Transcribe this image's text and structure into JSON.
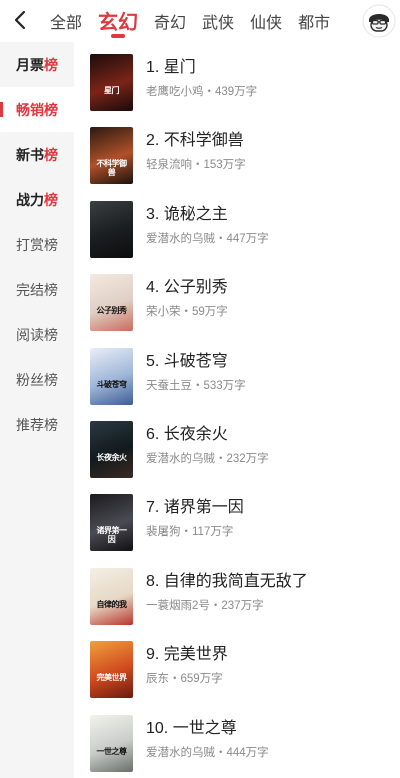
{
  "nav": {
    "tabs": [
      "全部",
      "玄幻",
      "奇幻",
      "武侠",
      "仙侠",
      "都市"
    ],
    "active_tab": 1
  },
  "sidebar": {
    "items": [
      {
        "label": "月票",
        "suffix": "榜",
        "style": "bold"
      },
      {
        "label": "畅销榜",
        "suffix": "",
        "style": "active"
      },
      {
        "label": "新书",
        "suffix": "榜",
        "style": "bold"
      },
      {
        "label": "战力",
        "suffix": "榜",
        "style": "bold"
      },
      {
        "label": "打赏榜",
        "suffix": "",
        "style": "normal"
      },
      {
        "label": "完结榜",
        "suffix": "",
        "style": "normal"
      },
      {
        "label": "阅读榜",
        "suffix": "",
        "style": "normal"
      },
      {
        "label": "粉丝榜",
        "suffix": "",
        "style": "normal"
      },
      {
        "label": "推荐榜",
        "suffix": "",
        "style": "normal"
      }
    ]
  },
  "books": [
    {
      "title": "1. 星门",
      "meta": "老鹰吃小鸡・439万字",
      "cover_text": "星门",
      "cover_colors": [
        "#1b0d0b",
        "#7a2418",
        "#1a0a0a"
      ],
      "cover_text_dark": false
    },
    {
      "title": "2. 不科学御兽",
      "meta": "轻泉流响・153万字",
      "cover_text": "不科学御兽",
      "cover_colors": [
        "#2a1a10",
        "#b0502a",
        "#1a120c"
      ],
      "cover_text_dark": false
    },
    {
      "title": "3. 诡秘之主",
      "meta": "爱潜水的乌贼・447万字",
      "cover_text": "",
      "cover_colors": [
        "#3a3f42",
        "#1a1d1f",
        "#0c0d0e"
      ],
      "cover_text_dark": false
    },
    {
      "title": "4. 公子别秀",
      "meta": "荣小荣・59万字",
      "cover_text": "公子别秀",
      "cover_colors": [
        "#f2e9e2",
        "#e0cfc4",
        "#c96b5c"
      ],
      "cover_text_dark": true
    },
    {
      "title": "5. 斗破苍穹",
      "meta": "天蚕土豆・533万字",
      "cover_text": "斗破苍穹",
      "cover_colors": [
        "#e8eef7",
        "#9fb6d8",
        "#3c5c92"
      ],
      "cover_text_dark": true
    },
    {
      "title": "6. 长夜余火",
      "meta": "爱潜水的乌贼・232万字",
      "cover_text": "长夜余火",
      "cover_colors": [
        "#2a3a40",
        "#121a1d",
        "#3b2a22"
      ],
      "cover_text_dark": false
    },
    {
      "title": "7. 诸界第一因",
      "meta": "裴屠狗・117万字",
      "cover_text": "诸界第一因",
      "cover_colors": [
        "#1a1a1e",
        "#4a4a52",
        "#101012"
      ],
      "cover_text_dark": false
    },
    {
      "title": "8. 自律的我简直无敌了",
      "meta": "一蓑烟雨2号・237万字",
      "cover_text": "自律的我",
      "cover_colors": [
        "#f4efe6",
        "#e6d8c4",
        "#b8342a"
      ],
      "cover_text_dark": true
    },
    {
      "title": "9. 完美世界",
      "meta": "辰东・659万字",
      "cover_text": "完美世界",
      "cover_colors": [
        "#f0a040",
        "#d04a1e",
        "#6a1a10"
      ],
      "cover_text_dark": false
    },
    {
      "title": "10. 一世之尊",
      "meta": "爱潜水的乌贼・444万字",
      "cover_text": "一世之尊",
      "cover_colors": [
        "#f2f2ee",
        "#c8ccc8",
        "#6a6e6a"
      ],
      "cover_text_dark": true
    }
  ],
  "icons": {
    "back": "chevron-left-icon",
    "avatar": "user-avatar-icon"
  },
  "colors": {
    "accent": "#e0383f",
    "sidebar_bg": "#f5f5f5",
    "meta_text": "#8a8a8a"
  }
}
